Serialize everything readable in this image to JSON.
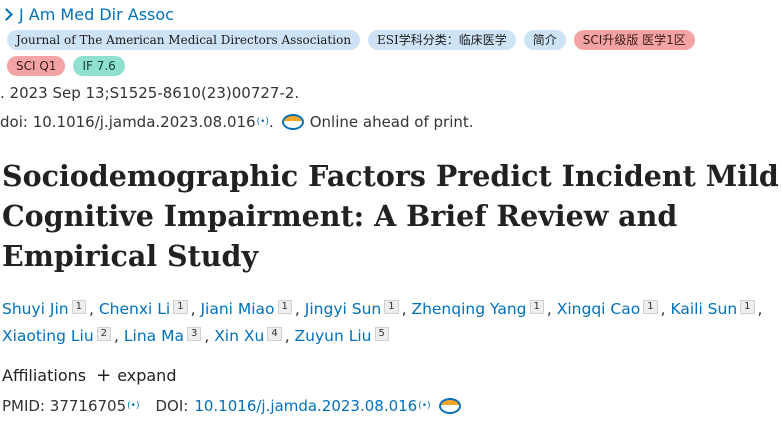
{
  "journal": {
    "name": "J Am Med Dir Assoc"
  },
  "badges_row1": [
    {
      "label": "Journal of The American Medical Directors Association",
      "style": "blue"
    },
    {
      "label": "ESI学科分类：临床医学",
      "style": "blue"
    },
    {
      "label": "简介",
      "style": "blue"
    },
    {
      "label": "SCI升级版 医学1区",
      "style": "red"
    }
  ],
  "badges_row2": [
    {
      "label": "SCI Q1",
      "style": "red"
    },
    {
      "label": "IF 7.6",
      "style": "green"
    }
  ],
  "citation": ". 2023 Sep 13;S1525-8610(23)00727-2.",
  "doi_line": {
    "prefix": "doi: 10.1016/j.jamda.2023.08.016",
    "suffix": ".",
    "status": "Online ahead of print."
  },
  "title": "Sociodemographic Factors Predict Incident Mild Cognitive Impairment: A Brief Review and Empirical Study",
  "authors": [
    {
      "name": "Shuyi Jin",
      "aff": "1"
    },
    {
      "name": "Chenxi Li",
      "aff": "1"
    },
    {
      "name": "Jiani Miao",
      "aff": "1"
    },
    {
      "name": "Jingyi Sun",
      "aff": "1"
    },
    {
      "name": "Zhenqing Yang",
      "aff": "1"
    },
    {
      "name": "Xingqi Cao",
      "aff": "1"
    },
    {
      "name": "Kaili Sun",
      "aff": "1"
    },
    {
      "name": "Xiaoting Liu",
      "aff": "2"
    },
    {
      "name": "Lina Ma",
      "aff": "3"
    },
    {
      "name": "Xin Xu",
      "aff": "4"
    },
    {
      "name": "Zuyun Liu",
      "aff": "5"
    }
  ],
  "affiliations": {
    "label": "Affiliations",
    "expand": "expand"
  },
  "ids": {
    "pmid": "PMID: 37716705",
    "doi_label": "DOI:",
    "doi": "10.1016/j.jamda.2023.08.016"
  },
  "icons": {
    "external": "(•)",
    "globe": "globe-icon",
    "chevron": "chevron-right-icon",
    "plus": "+"
  }
}
